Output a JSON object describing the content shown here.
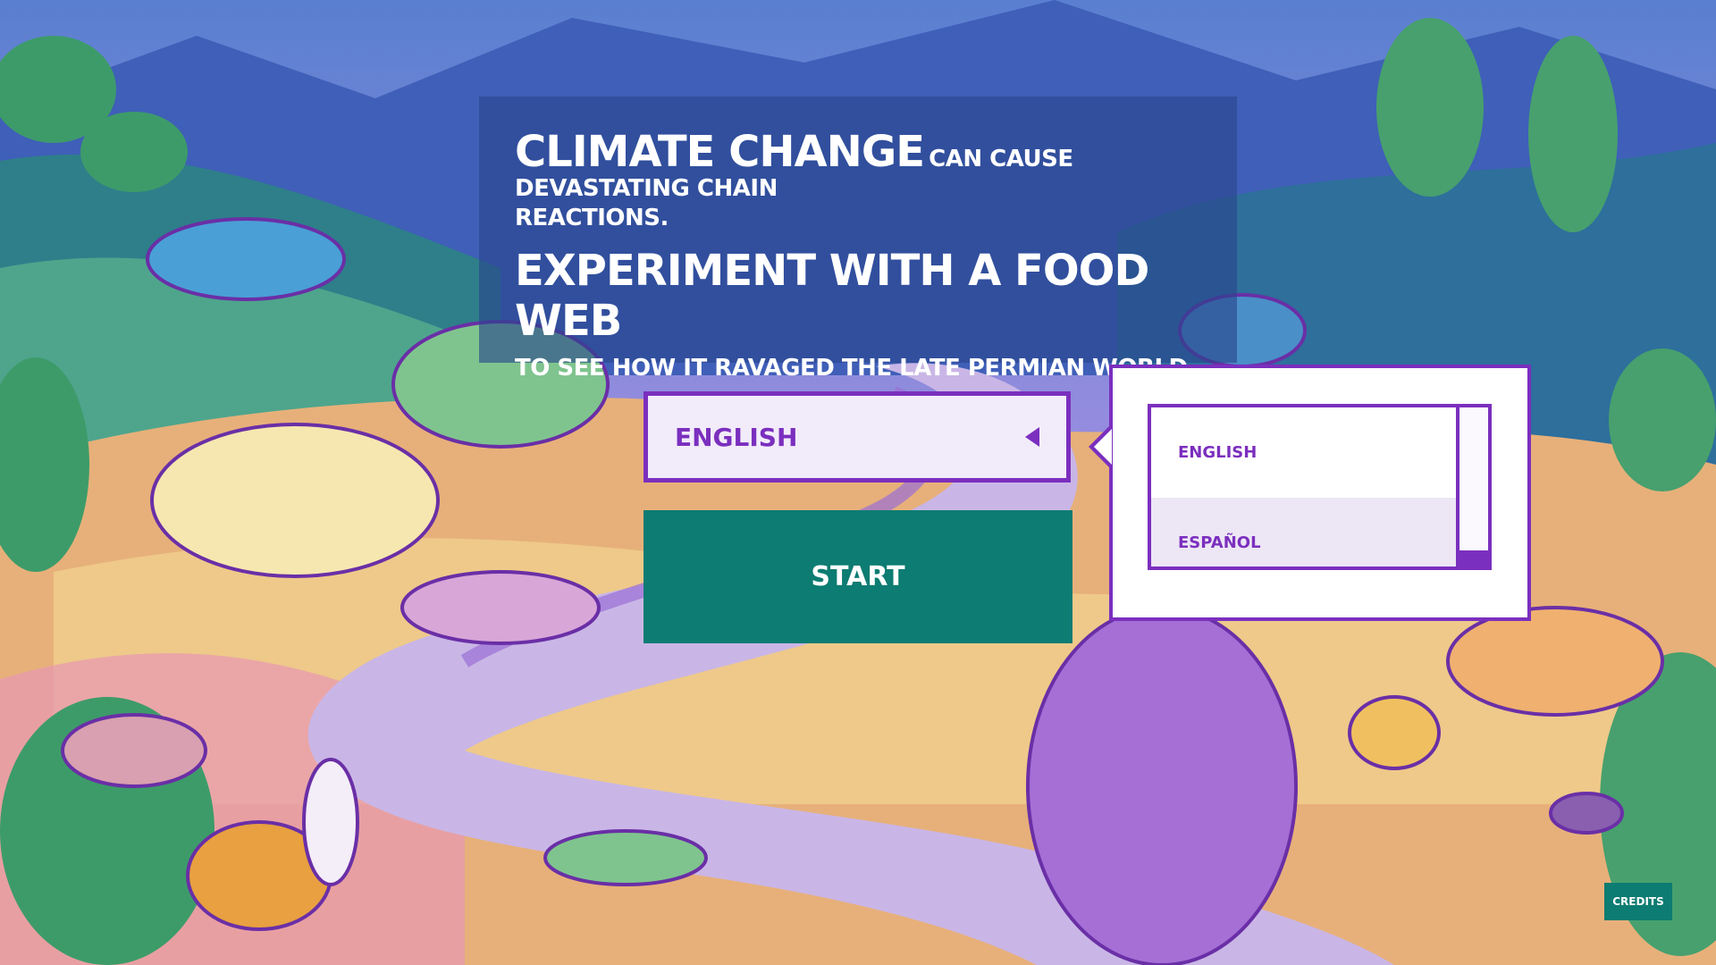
{
  "intro": {
    "line1_big": "CLIMATE CHANGE",
    "line1_small": "CAN CAUSE DEVASTATING CHAIN",
    "line2": "REACTIONS.",
    "line3": "EXPERIMENT WITH A FOOD WEB",
    "line4": "TO SEE HOW IT RAVAGED THE LATE PERMIAN WORLD."
  },
  "language_select": {
    "selected": "ENGLISH",
    "options": [
      "ENGLISH",
      "ESPAÑOL"
    ]
  },
  "start_button": {
    "label": "START"
  },
  "credits_button": {
    "label": "CREDITS"
  },
  "colors": {
    "accent_purple": "#7b2fbe",
    "button_teal": "#0d7c72",
    "panel_overlay": "#28468c"
  },
  "background": {
    "description_icon": "late-permian-landscape-illustration"
  }
}
